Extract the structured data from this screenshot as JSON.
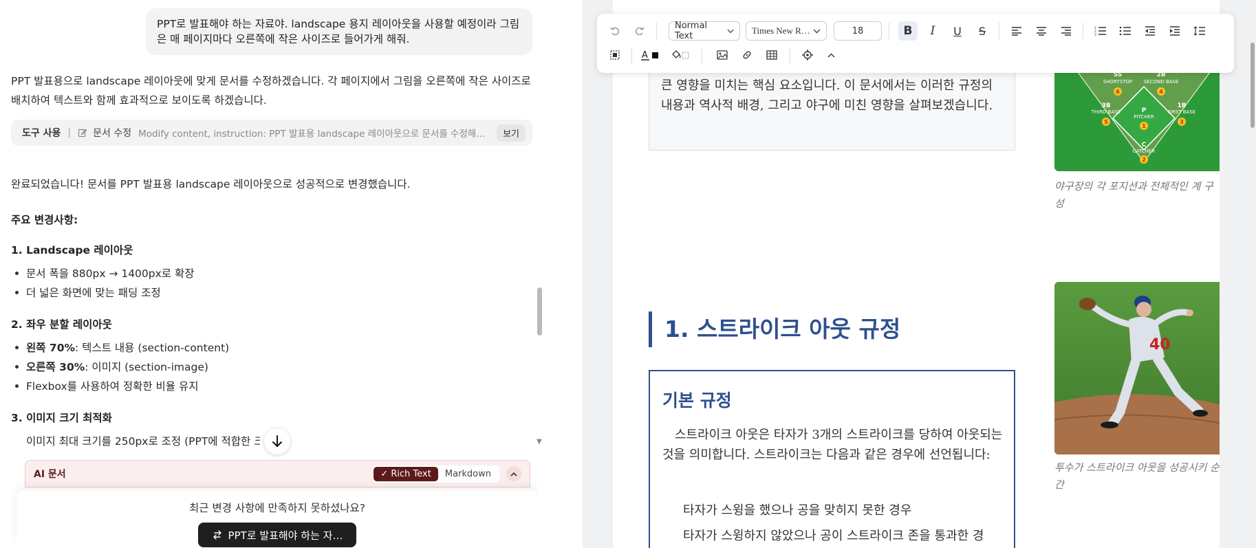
{
  "chat": {
    "user_message": "PPT로 발표해야 하는 자료야. landscape 용지 레이아웃을 사용할 예정이라 그림은 매 페이지마다 오른쪽에 작은 사이즈로 들어가게 해줘.",
    "assistant_intro": "PPT 발표용으로 landscape 레이아웃에 맞게 문서를 수정하겠습니다. 각 페이지에서 그림을 오른쪽에 작은 사이즈로 배치하여 텍스트와 함께 효과적으로 보이도록 하겠습니다.",
    "tool": {
      "label": "도구 사용",
      "name": "문서 수정",
      "description": "Modify content, instruction: PPT 발표용 landscape 레이아웃으로 문서를 수정해주세요.",
      "view_label": "보기"
    },
    "done_message": "완료되었습니다! 문서를 PPT 발표용 landscape 레이아웃으로 성공적으로 변경했습니다.",
    "changes_heading": "주요 변경사항:",
    "sections": [
      {
        "heading": "1. Landscape 레이아웃",
        "items": [
          {
            "bold": "",
            "text": "문서 폭을 880px → 1400px로 확장"
          },
          {
            "bold": "",
            "text": "더 넓은 화면에 맞는 패딩 조정"
          }
        ]
      },
      {
        "heading": "2. 좌우 분할 레이아웃",
        "items": [
          {
            "bold": "왼쪽 70%",
            "text": ": 텍스트 내용 (section-content)"
          },
          {
            "bold": "오른쪽 30%",
            "text": ": 이미지 (section-image)"
          },
          {
            "bold": "",
            "text": "Flexbox를 사용하여 정확한 비율 유지"
          }
        ]
      },
      {
        "heading": "3. 이미지 크기 최적화",
        "items": [
          {
            "bold": "",
            "text": "이미지 최대 크기를 250px로 조정 (PPT에 적합한 크"
          }
        ]
      }
    ],
    "ai_doc": {
      "title": "AI 문서",
      "toggle_rich": "Rich Text",
      "toggle_markdown": "Markdown"
    },
    "feedback": {
      "question": "최근 변경 사항에 만족하지 못하셨나요?",
      "retry_label": "PPT로 발표해야 하는 자…"
    }
  },
  "toolbar": {
    "style_select": "Normal Text",
    "font_select": "Times New R…",
    "font_size": "18"
  },
  "doc": {
    "intro_text": "큰 영향을 미치는 핵심 요소입니다. 이 문서에서는 이러한 규정의 내용과 역사적 배경, 그리고 야구에 미친 영향을 살펴보겠습니다.",
    "figure1": {
      "labels": {
        "ss": "SS",
        "shortstop": "SHORTSTOP",
        "b2": "2B",
        "second_base": "SECOND BASE",
        "b3": "3B",
        "third_base": "THIRD BASE",
        "b1": "1B",
        "first_base": "FIRST BASE",
        "p": "P",
        "pitcher": "PITCHER",
        "c": "C",
        "catcher": "CATCHER",
        "n1": "1",
        "n2": "2",
        "n3": "3",
        "n4": "4",
        "n5": "5",
        "n6": "6"
      },
      "caption": "야구장의 각 포지션과 전체적인 계 구성"
    },
    "section_title": "1. 스트라이크 아웃 규정",
    "rule_heading": "기본 규정",
    "rule_text": "스트라이크 아웃은 타자가 3개의 스트라이크를 당하여 아웃되는 것을 의미합니다. 스트라이크는 다음과 같은 경우에 선언됩니다:",
    "rule_items": [
      "타자가 스윙을 했으나 공을 맞히지 못한 경우",
      "타자가 스윙하지 않았으나 공이 스트라이크 존을 통과한 경"
    ],
    "figure2": {
      "jersey_number": "40",
      "caption": "투수가 스트라이크 아웃을 성공시키 순간"
    }
  },
  "colors": {
    "accent_blue": "#2f4f8f",
    "dark_button": "#1f1f1f",
    "ai_doc_bg": "#fbeeee",
    "rich_text_active": "#5c1a1a"
  }
}
